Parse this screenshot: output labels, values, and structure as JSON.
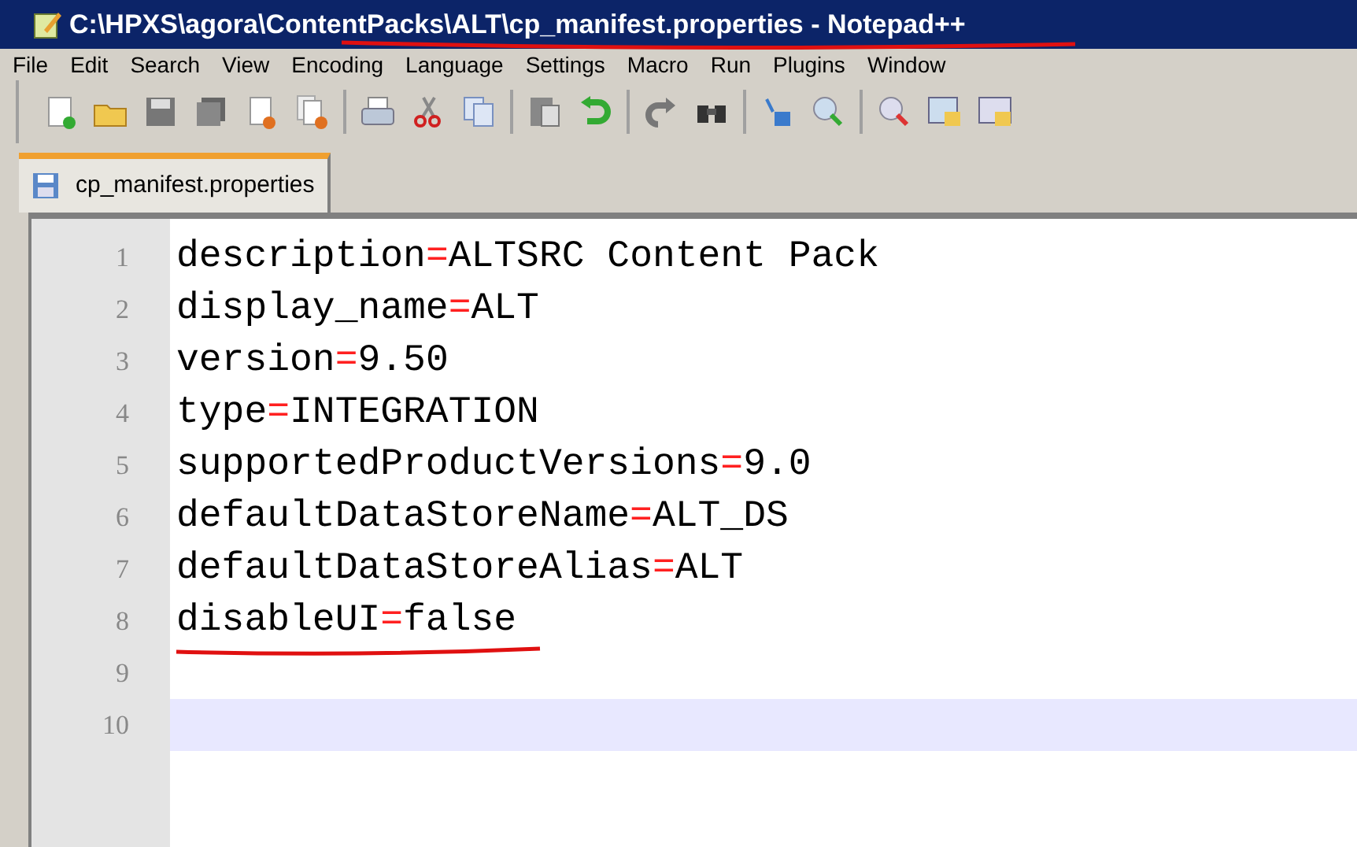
{
  "window": {
    "title": "C:\\HPXS\\agora\\ContentPacks\\ALT\\cp_manifest.properties - Notepad++",
    "title_underlined": true
  },
  "menu": [
    "File",
    "Edit",
    "Search",
    "View",
    "Encoding",
    "Language",
    "Settings",
    "Macro",
    "Run",
    "Plugins",
    "Window"
  ],
  "tabs": [
    {
      "label": "cp_manifest.properties",
      "selected": true
    }
  ],
  "lines": [
    {
      "number": "1",
      "key": "description",
      "operator": "=",
      "value": "ALTSRC Content Pack",
      "current": false,
      "underlined": false
    },
    {
      "number": "2",
      "key": "display_name",
      "operator": "=",
      "value": "ALT",
      "current": false,
      "underlined": false
    },
    {
      "number": "3",
      "key": "version",
      "operator": "=",
      "value": "9.50",
      "current": false,
      "underlined": false
    },
    {
      "number": "4",
      "key": "type",
      "operator": "=",
      "value": "INTEGRATION",
      "current": false,
      "underlined": false
    },
    {
      "number": "5",
      "key": "supportedProductVersions",
      "operator": "=",
      "value": "9.0",
      "current": false,
      "underlined": false
    },
    {
      "number": "6",
      "key": "defaultDataStoreName",
      "operator": "=",
      "value": "ALT_DS",
      "current": false,
      "underlined": false
    },
    {
      "number": "7",
      "key": "defaultDataStoreAlias",
      "operator": "=",
      "value": "ALT",
      "current": false,
      "underlined": false
    },
    {
      "number": "8",
      "key": "disableUI",
      "operator": "=",
      "value": "false",
      "current": false,
      "underlined": true
    },
    {
      "number": "9",
      "current": false,
      "underlined": false
    },
    {
      "number": "10",
      "current": true,
      "underlined": false
    }
  ]
}
